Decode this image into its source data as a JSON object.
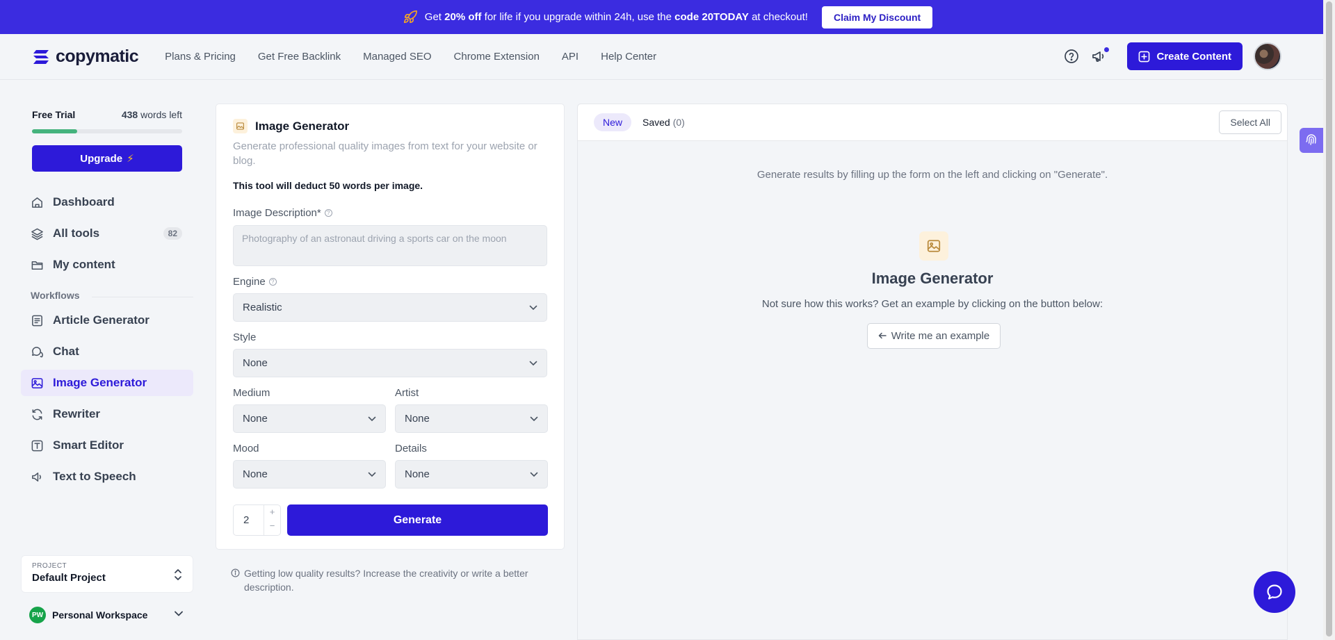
{
  "promo": {
    "prefix": "Get",
    "discount": "20% off",
    "middle": "for life if you upgrade within 24h, use the",
    "code": "code 20TODAY",
    "suffix": "at checkout!",
    "claim_label": "Claim My Discount",
    "background": "#3b2ce0"
  },
  "brand": {
    "name": "copymatic",
    "accent": "#2d1ad9"
  },
  "nav": {
    "links": [
      "Plans & Pricing",
      "Get Free Backlink",
      "Managed SEO",
      "Chrome Extension",
      "API",
      "Help Center"
    ],
    "create_label": "Create Content",
    "icons": [
      "help-circle-icon",
      "megaphone-icon"
    ]
  },
  "sidebar": {
    "plan": "Free Trial",
    "words_count": "438",
    "words_label": "words left",
    "words_progress": 0.3,
    "upgrade_label": "Upgrade",
    "items": [
      {
        "label": "Dashboard",
        "icon": "home-icon"
      },
      {
        "label": "All tools",
        "icon": "layers-icon",
        "badge": "82"
      },
      {
        "label": "My content",
        "icon": "folder-icon"
      }
    ],
    "workflows_label": "Workflows",
    "workflows": [
      {
        "label": "Article Generator",
        "icon": "article-icon"
      },
      {
        "label": "Chat",
        "icon": "chat-icon"
      },
      {
        "label": "Image Generator",
        "icon": "image-icon",
        "active": true
      },
      {
        "label": "Rewriter",
        "icon": "refresh-icon"
      },
      {
        "label": "Smart Editor",
        "icon": "text-box-icon"
      },
      {
        "label": "Text to Speech",
        "icon": "speaker-icon"
      }
    ],
    "project_label": "PROJECT",
    "project_value": "Default Project",
    "workspace_initials": "PW",
    "workspace_name": "Personal Workspace"
  },
  "form": {
    "title": "Image Generator",
    "description": "Generate professional quality images from text for your website or blog.",
    "deduct_note": "This tool will deduct 50 words per image.",
    "image_description_label": "Image Description*",
    "image_description_placeholder": "Photography of an astronaut driving a sports car on the moon",
    "engine_label": "Engine",
    "engine_value": "Realistic",
    "style_label": "Style",
    "style_value": "None",
    "medium_label": "Medium",
    "medium_value": "None",
    "artist_label": "Artist",
    "artist_value": "None",
    "mood_label": "Mood",
    "mood_value": "None",
    "details_label": "Details",
    "details_value": "None",
    "quantity": "2",
    "generate_label": "Generate",
    "hint": "Getting low quality results? Increase the creativity or write a better description."
  },
  "results": {
    "tab_new": "New",
    "tab_saved": "Saved",
    "saved_count": "(0)",
    "select_all": "Select All",
    "message": "Generate results by filling up the form on the left and clicking on \"Generate\".",
    "title": "Image Generator",
    "subtitle": "Not sure how this works? Get an example by clicking on the button below:",
    "example_label": "Write me an example"
  }
}
